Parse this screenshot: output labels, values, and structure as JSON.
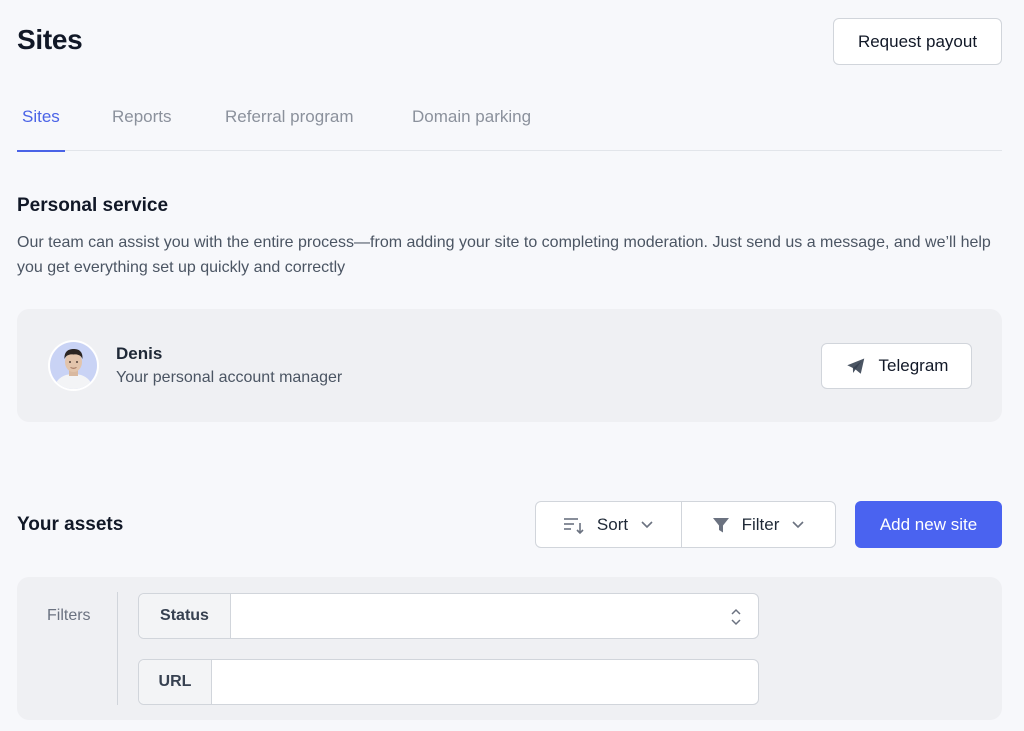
{
  "header": {
    "title": "Sites",
    "request_payout_label": "Request payout"
  },
  "tabs": [
    {
      "label": "Sites",
      "active": true
    },
    {
      "label": "Reports",
      "active": false
    },
    {
      "label": "Referral program",
      "active": false
    },
    {
      "label": "Domain parking",
      "active": false
    }
  ],
  "personal_service": {
    "heading": "Personal service",
    "description": "Our team can assist you with the entire process—from adding your site to completing moderation. Just send us a message, and we’ll help you get everything set up quickly and correctly",
    "manager": {
      "name": "Denis",
      "role": "Your personal account manager",
      "avatar_icon": "person-avatar"
    },
    "telegram_label": "Telegram",
    "telegram_icon": "paper-plane-icon"
  },
  "assets": {
    "heading": "Your assets",
    "sort_label": "Sort",
    "filter_label": "Filter",
    "add_site_label": "Add new site"
  },
  "filters": {
    "label": "Filters",
    "status_label": "Status",
    "status_value": "",
    "url_label": "URL",
    "url_value": ""
  },
  "colors": {
    "accent": "#4a63e7",
    "primary_button": "#4a63f0",
    "background": "#f7f8fb",
    "panel": "#eff0f3"
  }
}
